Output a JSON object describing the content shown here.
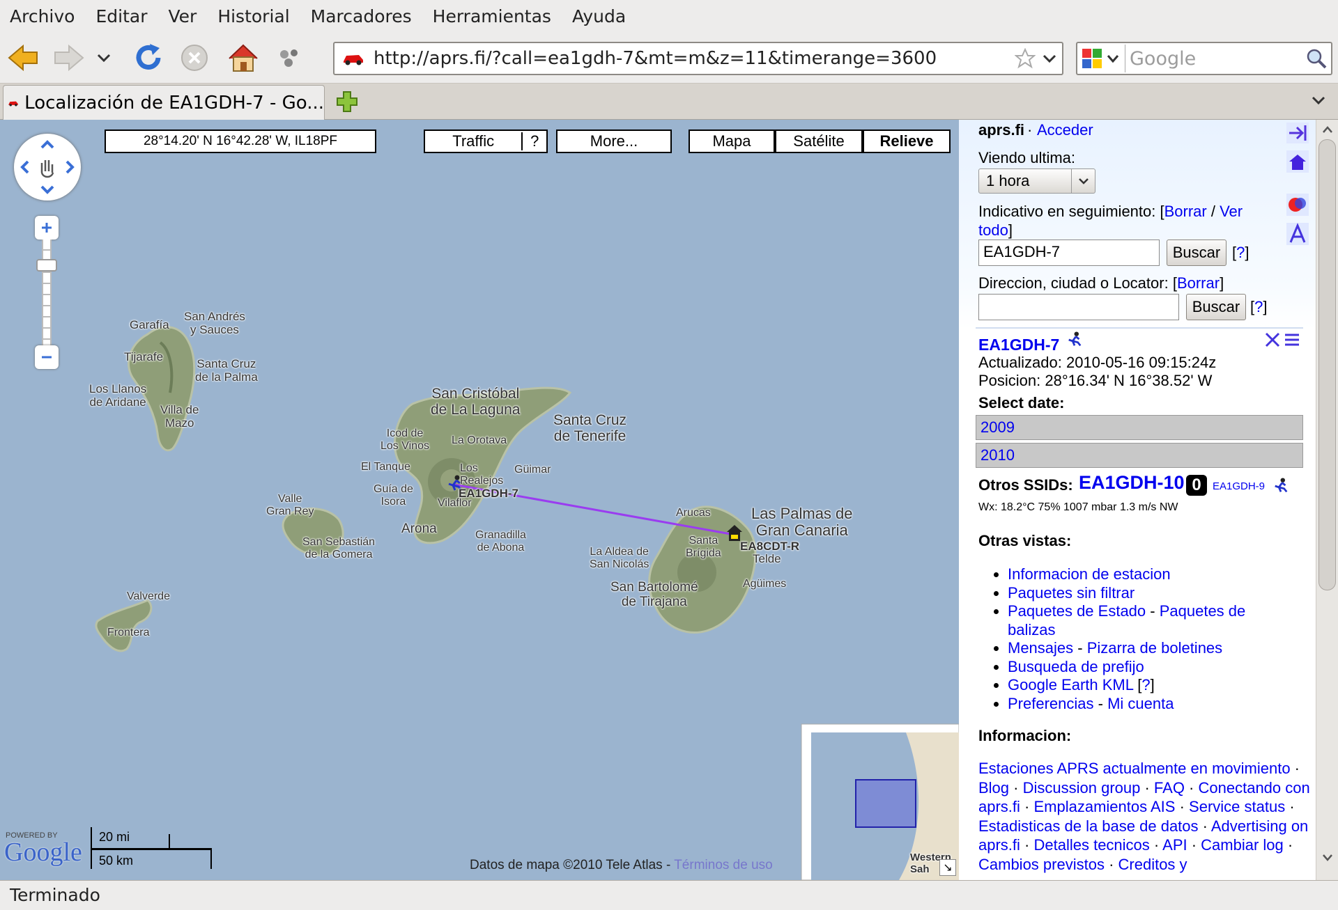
{
  "menu": [
    "Archivo",
    "Editar",
    "Ver",
    "Historial",
    "Marcadores",
    "Herramientas",
    "Ayuda"
  ],
  "nav": {
    "url": "http://aprs.fi/?call=ea1gdh-7&mt=m&z=11&timerange=3600",
    "search_placeholder": "Google"
  },
  "tab": {
    "title": "Localización de EA1GDH-7 - Go..."
  },
  "map": {
    "coords": "28°14.20' N 16°42.28' W, IL18PF",
    "traffic": "Traffic",
    "traffic_help": "?",
    "more": "More...",
    "types": [
      "Mapa",
      "Satélite",
      "Relieve"
    ],
    "active_type": "Relieve",
    "places": {
      "san_andres": "San Andrés\ny Sauces",
      "garafia": "Garafía",
      "tijarafe": "Tijarafe",
      "santa_cruz_palma": "Santa Cruz\nde la Palma",
      "los_llanos": "Los Llanos\nde Aridane",
      "villa_mazo": "Villa de\nMazo",
      "san_cristobal": "San Cristóbal\nde La Laguna",
      "santa_cruz_tenerife": "Santa Cruz\nde Tenerife",
      "icod": "Icod de\nLos Vinos",
      "la_orotava": "La Orotava",
      "el_tanque": "El Tanque",
      "los_realejos": "Los\nRealejos",
      "guimar": "Güimar",
      "guia_isora": "Guía de\nIsora",
      "vilaflor": "Vilaflor",
      "arona": "Arona",
      "granadilla": "Granadilla\nde Abona",
      "valle_gran_rey": "Valle\nGran Rey",
      "san_sebastian": "San Sebastián\nde la Gomera",
      "valverde": "Valverde",
      "frontera": "Frontera",
      "arucas": "Arucas",
      "las_palmas": "Las Palmas de\nGran Canaria",
      "santa_brigida": "Santa\nBrígida",
      "telde": "Telde",
      "la_aldea": "La Aldea de\nSan Nicolás",
      "aguimes": "Agüimes",
      "san_bartolome": "San Bartolomé\nde Tirajana",
      "western_sahara": "Western\nSah"
    },
    "station1": "EA1GDH-7",
    "station2": "EA8CDT-R",
    "powered_by": "POWERED BY",
    "google": "Google",
    "scale_mi": "20 mi",
    "scale_km": "50 km",
    "attribution": "Datos de mapa ©2010 Tele Atlas -",
    "terms": "Términos de uso"
  },
  "panel": {
    "site": "aprs.fi",
    "login": "Acceder",
    "viewing_label": "Viendo ultima:",
    "viewing_value": "1 hora",
    "tracking_label": "Indicativo en seguimiento: [",
    "clear": "Borrar",
    "view_all": "Ver todo",
    "callsign_value": "EA1GDH-7",
    "search_btn": "Buscar",
    "help": "?",
    "address_label": "Direccion, ciudad o Locator: [",
    "station_name": "EA1GDH-7",
    "updated": "Actualizado: 2010-05-16 09:15:24z",
    "position": "Posicion: 28°16.34' N 16°38.52' W",
    "select_date": "Select date:",
    "years": [
      "2009",
      "2010"
    ],
    "other_ssids_label": "Otros SSIDs:",
    "ssid_main": "EA1GDH-10",
    "ssid_small": "EA1GDH-9",
    "wx": "Wx: 18.2°C 75% 1007 mbar 1.3 m/s NW",
    "other_views": "Otras vistas:",
    "links": {
      "info": "Informacion de estacion",
      "raw": "Paquetes sin filtrar",
      "status": "Paquetes de Estado",
      "beacon": "Paquetes de balizas",
      "messages": "Mensajes",
      "bulletins": "Pizarra de boletines",
      "prefix": "Busqueda de prefijo",
      "kml": "Google Earth KML",
      "prefs": "Preferencias",
      "account": "Mi cuenta"
    },
    "info_label": "Informacion:",
    "info_links": {
      "moving": "Estaciones APRS actualmente en movimiento",
      "blog": "Blog",
      "discussion": "Discussion group",
      "faq": "FAQ",
      "connecting": "Conectando con aprs.fi",
      "ais": "Emplazamientos AIS",
      "service": "Service status",
      "stats": "Estadisticas de la base de datos",
      "advertising": "Advertising on aprs.fi",
      "tech": "Detalles tecnicos",
      "api": "API",
      "changelog": "Cambiar log",
      "planned": "Cambios previstos",
      "credits": "Creditos y"
    }
  },
  "status": "Terminado"
}
